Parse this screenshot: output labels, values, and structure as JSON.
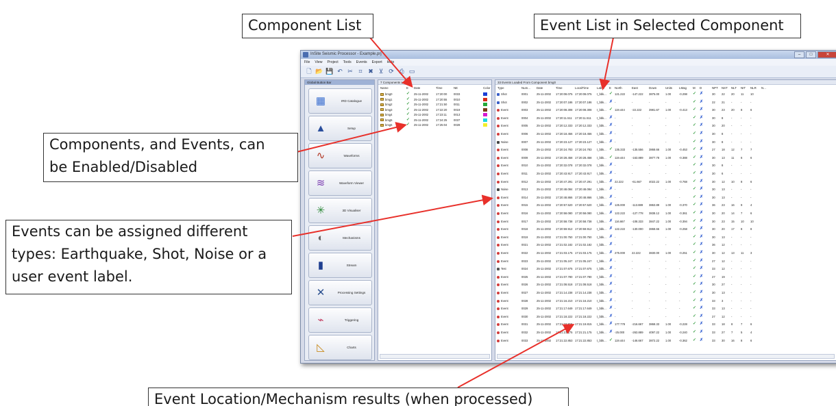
{
  "callouts": {
    "component_list": "Component List",
    "event_list": "Event List in Selected Component",
    "enable_disable": [
      "Components, and Events, can",
      "be Enabled/Disabled"
    ],
    "event_types": [
      "Events can be assigned different",
      "types: Earthquake, Shot, Noise or a",
      "user event label."
    ],
    "location_results": "Event Location/Mechanism results (when processed)"
  },
  "colors": {
    "arrow": "#e8302a",
    "enabled_check": "#2f9a3b",
    "disabled_cross": "#2d5bd0"
  },
  "window": {
    "title": "InSite Seismic Processor - Example.prj",
    "menu": [
      "File",
      "View",
      "Project",
      "Tools",
      "Events",
      "Export",
      "Help"
    ],
    "toolbar_icons": [
      "new-icon",
      "open-icon",
      "save-icon",
      "undo-icon",
      "tools-icon",
      "select-icon",
      "delete-icon",
      "filter-icon",
      "refresh-icon",
      "print-icon",
      "monitor-icon"
    ]
  },
  "nav": {
    "header": "Global Button Bar",
    "items": [
      {
        "label": "IRD Catalogue",
        "icon": "catalogue-icon"
      },
      {
        "label": "Setup",
        "icon": "setup-icon"
      },
      {
        "label": "Waveforms",
        "icon": "waveforms-icon"
      },
      {
        "label": "Waveform Viewer",
        "icon": "waveform-viewer-icon"
      },
      {
        "label": "3D Visualiser",
        "icon": "visualiser-icon"
      },
      {
        "label": "Mechanisms",
        "icon": "mechanisms-icon"
      },
      {
        "label": "Stream",
        "icon": "stream-icon"
      },
      {
        "label": "Processing Settings",
        "icon": "processing-settings-icon"
      },
      {
        "label": "Triggering",
        "icon": "triggering-icon"
      },
      {
        "label": "Charts",
        "icon": "charts-icon"
      }
    ]
  },
  "components": {
    "header": "7 Components Loaded",
    "columns": [
      "Name",
      "E",
      "Date",
      "Time",
      "NE",
      "Color"
    ],
    "rows": [
      {
        "name": "bmg0",
        "date": "25-11-2002",
        "time": "17:20:00",
        "ne": "0033",
        "color": "#1a3fd6"
      },
      {
        "name": "bmg1",
        "date": "25-11-2002",
        "time": "17:20:55",
        "ne": "0010",
        "color": "#d62a1a"
      },
      {
        "name": "bmg2",
        "date": "25-11-2002",
        "time": "17:21:50",
        "ne": "0011",
        "color": "#24a83a"
      },
      {
        "name": "bmg3",
        "date": "25-11-2002",
        "time": "17:22:20",
        "ne": "0019",
        "color": "#7a3c14"
      },
      {
        "name": "bmg4",
        "date": "25-11-2002",
        "time": "17:23:11",
        "ne": "0013",
        "color": "#d61ad0"
      },
      {
        "name": "bmg5",
        "date": "25-11-2002",
        "time": "17:24:25",
        "ne": "0037",
        "color": "#18d8e0"
      },
      {
        "name": "bmg6",
        "date": "25-11-2002",
        "time": "17:25:04",
        "ne": "0028",
        "color": "#f2ef2a"
      }
    ]
  },
  "events": {
    "header": "33 Events Loaded From Component bmg0",
    "columns": [
      "Type",
      "Num...",
      "Date",
      "Time",
      "LocalTime",
      "Label",
      "E",
      "North",
      "East",
      "Down",
      "Units",
      "LMag",
      "M",
      "D",
      "NPT",
      "NST",
      "NLT",
      "NIT",
      "NLR",
      "N..."
    ],
    "rows": [
      [
        "Shot",
        "0001",
        "25-11-2002",
        "17:20:08.075",
        "17:20:08.075",
        "t_bbk...",
        "Y",
        "121.222",
        "-147.222",
        "3875.00",
        "1.00",
        "-0.298",
        "Y",
        "X",
        "30",
        "22",
        "20",
        "11",
        "10"
      ],
      [
        "Shot",
        "0002",
        "25-11-2002",
        "17:20:07.186",
        "17:20:07.186",
        "t_bbk...",
        "X",
        "-",
        "-",
        "-",
        "-",
        "-",
        "Y",
        "X",
        "22",
        "21",
        "-",
        "-",
        "-"
      ],
      [
        "Event",
        "0003",
        "25-11-2002",
        "17:20:08.308",
        "17:20:08.308",
        "t_bbk...",
        "Y",
        "119.444",
        "-22.222",
        "3981.67",
        "1.00",
        "-0.413",
        "Y",
        "X",
        "30",
        "23",
        "20",
        "8",
        "6"
      ],
      [
        "Event",
        "0004",
        "25-11-2002",
        "17:20:11.511",
        "17:20:11.511",
        "t_bbk...",
        "X",
        "-",
        "-",
        "-",
        "-",
        "-",
        "Y",
        "X",
        "30",
        "8",
        "-",
        "-",
        "-"
      ],
      [
        "Event",
        "0005",
        "25-11-2002",
        "17:20:12.333",
        "17:20:12.333",
        "t_bbk...",
        "X",
        "-",
        "-",
        "-",
        "-",
        "-",
        "Y",
        "X",
        "30",
        "20",
        "-",
        "-",
        "-"
      ],
      [
        "Event",
        "0006",
        "25-11-2002",
        "17:20:18.456",
        "17:20:18.456",
        "t_bbk...",
        "X",
        "-",
        "-",
        "-",
        "-",
        "-",
        "Y",
        "X",
        "30",
        "8",
        "-",
        "-",
        "-"
      ],
      [
        "Noise",
        "0007",
        "25-11-2002",
        "17:20:23.127",
        "17:20:23.127",
        "t_bbk...",
        "X",
        "-",
        "-",
        "-",
        "-",
        "-",
        "Y",
        "X",
        "30",
        "8",
        "-",
        "-",
        "-"
      ],
      [
        "Event",
        "0008",
        "25-11-2002",
        "17:20:24.783",
        "17:20:24.783",
        "t_bbk...",
        "Y",
        "135.333",
        "-135.556",
        "3868.66",
        "1.00",
        "-0.453",
        "Y",
        "X",
        "27",
        "18",
        "12",
        "7",
        "7"
      ],
      [
        "Event",
        "0009",
        "25-11-2002",
        "17:20:28.458",
        "17:20:28.458",
        "t_bbk...",
        "Y",
        "119.444",
        "-163.889",
        "3877.78",
        "1.00",
        "-0.388",
        "Y",
        "X",
        "30",
        "13",
        "11",
        "6",
        "6"
      ],
      [
        "Event",
        "0010",
        "25-11-2002",
        "17:20:32.078",
        "17:20:32.078",
        "t_bbk...",
        "X",
        "-",
        "-",
        "-",
        "-",
        "-",
        "Y",
        "X",
        "30",
        "8",
        "-",
        "-",
        "-"
      ],
      [
        "Event",
        "0011",
        "25-11-2002",
        "17:20:43.917",
        "17:20:43.917",
        "t_bbk...",
        "X",
        "-",
        "-",
        "-",
        "-",
        "-",
        "Y",
        "X",
        "30",
        "6",
        "-",
        "-",
        "-"
      ],
      [
        "Event",
        "0012",
        "25-11-2002",
        "17:20:47.291",
        "17:20:47.291",
        "t_bbk...",
        "X",
        "22.222",
        "-61.667",
        "4022.22",
        "1.00",
        "-0.768",
        "Y",
        "X",
        "30",
        "12",
        "10",
        "8",
        "6"
      ],
      [
        "Noise",
        "0013",
        "25-11-2002",
        "17:20:48.084",
        "17:20:48.084",
        "t_bbk...",
        "X",
        "-",
        "-",
        "-",
        "-",
        "-",
        "Y",
        "X",
        "30",
        "13",
        "-",
        "-",
        "-"
      ],
      [
        "Event",
        "0014",
        "25-11-2002",
        "17:20:48.866",
        "17:20:48.866",
        "t_bbk...",
        "X",
        "-",
        "-",
        "-",
        "-",
        "-",
        "Y",
        "X",
        "30",
        "13",
        "-",
        "-",
        "-"
      ],
      [
        "Event",
        "0015",
        "25-11-2002",
        "17:20:57.520",
        "17:20:57.520",
        "t_bbk...",
        "X",
        "125.000",
        "-113.889",
        "3863.89",
        "1.00",
        "-0.370",
        "Y",
        "X",
        "36",
        "23",
        "16",
        "9",
        "4"
      ],
      [
        "Event",
        "0016",
        "25-11-2002",
        "17:20:58.080",
        "17:20:58.080",
        "t_bbk...",
        "X",
        "122.222",
        "-127.778",
        "3838.12",
        "1.00",
        "-0.361",
        "Y",
        "X",
        "30",
        "20",
        "14",
        "7",
        "6"
      ],
      [
        "Event",
        "0017",
        "25-11-2002",
        "17:20:58.738",
        "17:20:58.738",
        "t_bbk...",
        "X",
        "116.667",
        "-108.333",
        "3847.22",
        "1.00",
        "-0.394",
        "Y",
        "X",
        "30",
        "23",
        "15",
        "10",
        "10"
      ],
      [
        "Event",
        "0018",
        "25-11-2002",
        "17:20:59.912",
        "17:20:59.912",
        "t_bbk...",
        "X",
        "122.222",
        "-130.000",
        "3868.66",
        "1.00",
        "-0.258",
        "Y",
        "X",
        "30",
        "20",
        "17",
        "8",
        "8"
      ],
      [
        "Event",
        "0019",
        "25-11-2002",
        "17:21:00.750",
        "17:21:00.750",
        "t_bbk...",
        "X",
        "-",
        "-",
        "-",
        "-",
        "-",
        "Y",
        "X",
        "30",
        "13",
        "-",
        "-",
        "-"
      ],
      [
        "Event",
        "0021",
        "25-11-2002",
        "17:21:02.182",
        "17:21:02.182",
        "t_bbk...",
        "X",
        "-",
        "-",
        "-",
        "-",
        "-",
        "Y",
        "X",
        "36",
        "12",
        "-",
        "-",
        "-"
      ],
      [
        "Event",
        "0022",
        "25-11-2002",
        "17:21:03.175",
        "17:21:03.175",
        "t_bbk...",
        "X",
        "275.000",
        "22.222",
        "3830.00",
        "1.00",
        "-0.251",
        "Y",
        "X",
        "30",
        "12",
        "13",
        "11",
        "3"
      ],
      [
        "Event",
        "0023",
        "25-11-2002",
        "17:21:05.247",
        "17:21:05.247",
        "t_bbk...",
        "X",
        "-",
        "-",
        "-",
        "-",
        "-",
        "Y",
        "X",
        "27",
        "12",
        "-",
        "-",
        "-"
      ],
      [
        "Test",
        "0024",
        "25-11-2002",
        "17:21:07.675",
        "17:21:07.675",
        "t_bbk...",
        "X",
        "-",
        "-",
        "-",
        "-",
        "-",
        "Y",
        "X",
        "33",
        "12",
        "-",
        "-",
        "-"
      ],
      [
        "Event",
        "0025",
        "25-11-2002",
        "17:21:07.780",
        "17:21:07.780",
        "t_bbk...",
        "X",
        "-",
        "-",
        "-",
        "-",
        "-",
        "Y",
        "X",
        "27",
        "19",
        "-",
        "-",
        "-"
      ],
      [
        "Event",
        "0026",
        "25-11-2002",
        "17:21:08.518",
        "17:21:08.518",
        "t_bbk...",
        "X",
        "-",
        "-",
        "-",
        "-",
        "-",
        "Y",
        "X",
        "30",
        "27",
        "-",
        "-",
        "-"
      ],
      [
        "Event",
        "0027",
        "25-11-2002",
        "17:21:14.238",
        "17:21:14.238",
        "t_bbk...",
        "X",
        "-",
        "-",
        "-",
        "-",
        "-",
        "Y",
        "X",
        "30",
        "13",
        "-",
        "-",
        "-"
      ],
      [
        "Event",
        "0028",
        "25-11-2002",
        "17:21:16.210",
        "17:21:16.210",
        "t_bbk...",
        "X",
        "-",
        "-",
        "-",
        "-",
        "-",
        "Y",
        "X",
        "33",
        "3",
        "-",
        "-",
        "-"
      ],
      [
        "Event",
        "0029",
        "25-11-2002",
        "17:21:17.649",
        "17:21:17.649",
        "t_bbk...",
        "X",
        "-",
        "-",
        "-",
        "-",
        "-",
        "Y",
        "X",
        "33",
        "13",
        "-",
        "-",
        "-"
      ],
      [
        "Event",
        "0030",
        "25-11-2002",
        "17:21:18.222",
        "17:21:18.222",
        "t_bbk...",
        "X",
        "-",
        "-",
        "-",
        "-",
        "-",
        "Y",
        "X",
        "27",
        "12",
        "-",
        "-",
        "-"
      ],
      [
        "Event",
        "0031",
        "25-11-2002",
        "17:21:19.815",
        "17:21:19.815",
        "t_bbk...",
        "X",
        "177.778",
        "-216.667",
        "3868.33",
        "1.00",
        "-0.228",
        "Y",
        "X",
        "33",
        "18",
        "8",
        "7",
        "6"
      ],
      [
        "Event",
        "0032",
        "25-11-2002",
        "17:21:21.175",
        "17:21:21.175",
        "t_bbk...",
        "X",
        "-25.000",
        "-263.889",
        "4097.22",
        "1.00",
        "-0.240",
        "Y",
        "X",
        "33",
        "27",
        "7",
        "5",
        "4"
      ],
      [
        "Event",
        "0033",
        "25-11-2002",
        "17:21:22.853",
        "17:21:22.853",
        "t_bbk...",
        "Y",
        "119.444",
        "-146.667",
        "3872.22",
        "1.00",
        "-0.362",
        "Y",
        "X",
        "33",
        "30",
        "16",
        "8",
        "6"
      ]
    ]
  }
}
